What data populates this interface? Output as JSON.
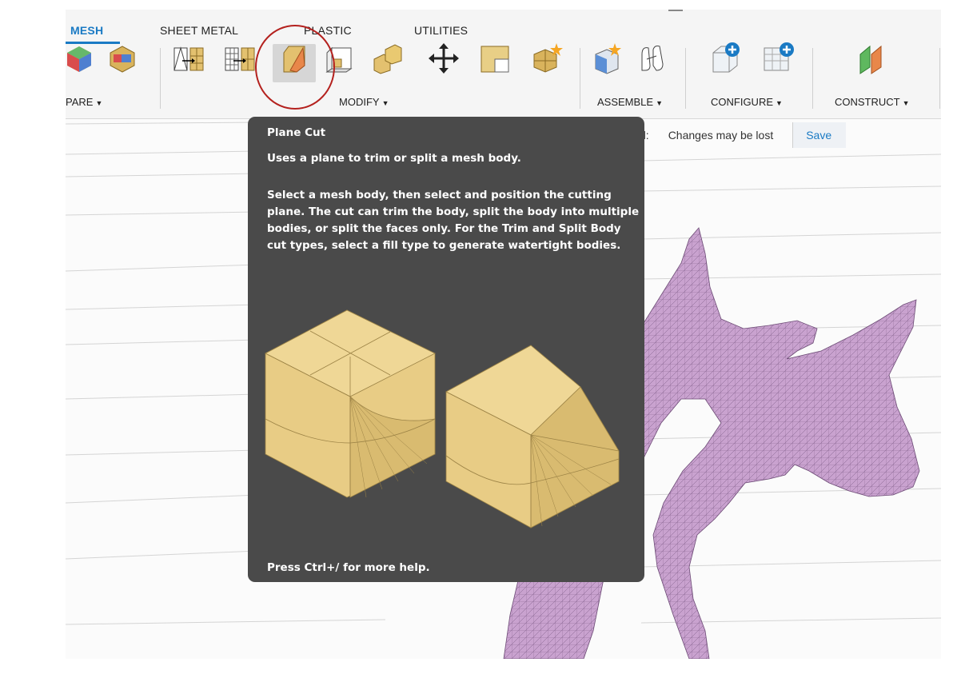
{
  "ribbon": {
    "tabs": [
      {
        "label": "MESH",
        "active": true
      },
      {
        "label": "SHEET METAL",
        "active": false
      },
      {
        "label": "PLASTIC",
        "active": false
      },
      {
        "label": "UTILITIES",
        "active": false
      }
    ],
    "groups": {
      "prepare": "PARE",
      "modify": "MODIFY",
      "assemble": "ASSEMBLE",
      "configure": "CONFIGURE",
      "construct": "CONSTRUCT"
    },
    "dropdown_icon": "caret-down-icon",
    "highlighted_tool": "plane-cut-icon"
  },
  "status_bar": {
    "prefix": "d:",
    "message": "Changes may be lost",
    "save_label": "Save"
  },
  "tooltip": {
    "title": "Plane Cut",
    "summary": "Uses a plane to trim or split a mesh body.",
    "description": "Select a mesh body, then select and position the cutting plane. The cut can trim the body, split the body into multiple bodies, or split the faces only. For the Trim and Split Body cut types, select a fill type to generate watertight bodies.",
    "footer": "Press Ctrl+/ for more help."
  },
  "colors": {
    "accent": "#1a7ac4",
    "tooltip_bg": "#4a4a4a",
    "mesh_fill": "#c9a2cf",
    "preview_fill": "#e8cc85",
    "annotation_circle": "#b4211e"
  }
}
